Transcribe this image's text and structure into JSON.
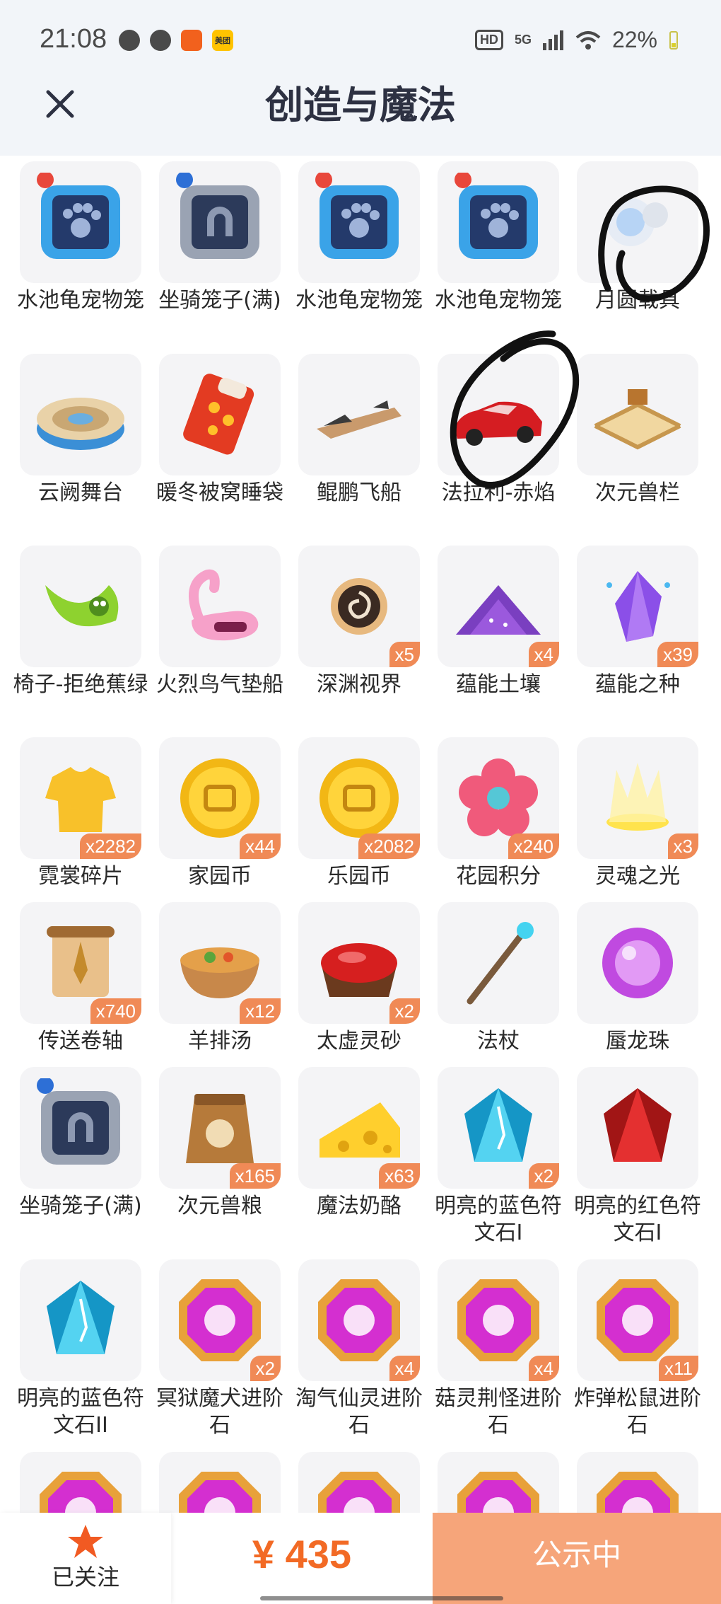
{
  "status": {
    "time": "21:08",
    "network": "5G",
    "hd": "HD",
    "battery": "22%",
    "app_badge_label": "美团"
  },
  "header": {
    "title": "创造与魔法"
  },
  "items": [
    {
      "name": "水池龟宠物笼",
      "icon": "pet-cage-blue-icon",
      "badge": ""
    },
    {
      "name": "坐骑笼子(满)",
      "icon": "mount-cage-icon",
      "badge": ""
    },
    {
      "name": "水池龟宠物笼",
      "icon": "pet-cage-blue-icon",
      "badge": ""
    },
    {
      "name": "水池龟宠物笼",
      "icon": "pet-cage-blue-icon",
      "badge": ""
    },
    {
      "name": "月圆载具",
      "icon": "moon-orb-icon",
      "badge": ""
    },
    {
      "name": "云阙舞台",
      "icon": "round-stage-icon",
      "badge": ""
    },
    {
      "name": "暖冬被窝睡袋",
      "icon": "sleeping-bag-icon",
      "badge": ""
    },
    {
      "name": "鲲鹏飞船",
      "icon": "airship-icon",
      "badge": ""
    },
    {
      "name": "法拉利-赤焰",
      "icon": "red-car-icon",
      "badge": ""
    },
    {
      "name": "次元兽栏",
      "icon": "fence-pen-icon",
      "badge": ""
    },
    {
      "name": "椅子-拒绝蕉绿",
      "icon": "banana-chair-icon",
      "badge": ""
    },
    {
      "name": "火烈鸟气垫船",
      "icon": "flamingo-float-icon",
      "badge": ""
    },
    {
      "name": "深渊视界",
      "icon": "abyss-sun-icon",
      "badge": "x5"
    },
    {
      "name": "蕴能土壤",
      "icon": "purple-soil-icon",
      "badge": "x4"
    },
    {
      "name": "蕴能之种",
      "icon": "purple-crystal-icon",
      "badge": "x39"
    },
    {
      "name": "霓裳碎片",
      "icon": "shirt-icon",
      "badge": "x2282"
    },
    {
      "name": "家园币",
      "icon": "gold-coin-icon",
      "badge": "x44"
    },
    {
      "name": "乐园币",
      "icon": "gold-coin-icon",
      "badge": "x2082"
    },
    {
      "name": "花园积分",
      "icon": "flower-icon",
      "badge": "x240"
    },
    {
      "name": "灵魂之光",
      "icon": "soul-light-icon",
      "badge": "x3"
    },
    {
      "name": "传送卷轴",
      "icon": "scroll-icon",
      "badge": "x740"
    },
    {
      "name": "羊排汤",
      "icon": "soup-bowl-icon",
      "badge": "x12"
    },
    {
      "name": "太虚灵砂",
      "icon": "red-sand-bowl-icon",
      "badge": "x2"
    },
    {
      "name": "法杖",
      "icon": "staff-icon",
      "badge": ""
    },
    {
      "name": "蜃龙珠",
      "icon": "purple-orb-icon",
      "badge": ""
    },
    {
      "name": "坐骑笼子(满)",
      "icon": "mount-cage-icon",
      "badge": ""
    },
    {
      "name": "次元兽粮",
      "icon": "food-bag-icon",
      "badge": "x165"
    },
    {
      "name": "魔法奶酪",
      "icon": "cheese-icon",
      "badge": "x63"
    },
    {
      "name": "明亮的蓝色符文石I",
      "icon": "blue-rune-icon",
      "badge": "x2"
    },
    {
      "name": "明亮的红色符文石I",
      "icon": "red-rune-icon",
      "badge": ""
    },
    {
      "name": "明亮的蓝色符文石II",
      "icon": "blue-rune-icon",
      "badge": ""
    },
    {
      "name": "冥狱魔犬进阶石",
      "icon": "evolve-stone-icon",
      "badge": "x2"
    },
    {
      "name": "淘气仙灵进阶石",
      "icon": "evolve-stone-icon",
      "badge": "x4"
    },
    {
      "name": "菇灵荆怪进阶石",
      "icon": "evolve-stone-icon",
      "badge": "x4"
    },
    {
      "name": "炸弹松鼠进阶石",
      "icon": "evolve-stone-icon",
      "badge": "x11"
    },
    {
      "name": "",
      "icon": "evolve-stone-icon",
      "badge": ""
    },
    {
      "name": "",
      "icon": "evolve-stone-icon",
      "badge": ""
    },
    {
      "name": "",
      "icon": "evolve-stone-icon",
      "badge": ""
    },
    {
      "name": "",
      "icon": "evolve-stone-icon",
      "badge": ""
    },
    {
      "name": "",
      "icon": "evolve-stone-icon",
      "badge": ""
    }
  ],
  "footer": {
    "follow_label": "已关注",
    "price": "¥ 435",
    "cta_label": "公示中"
  },
  "colors": {
    "accent": "#f26a25",
    "badge": "#f08a56",
    "cta": "#f6a57a",
    "title": "#2d3142"
  }
}
